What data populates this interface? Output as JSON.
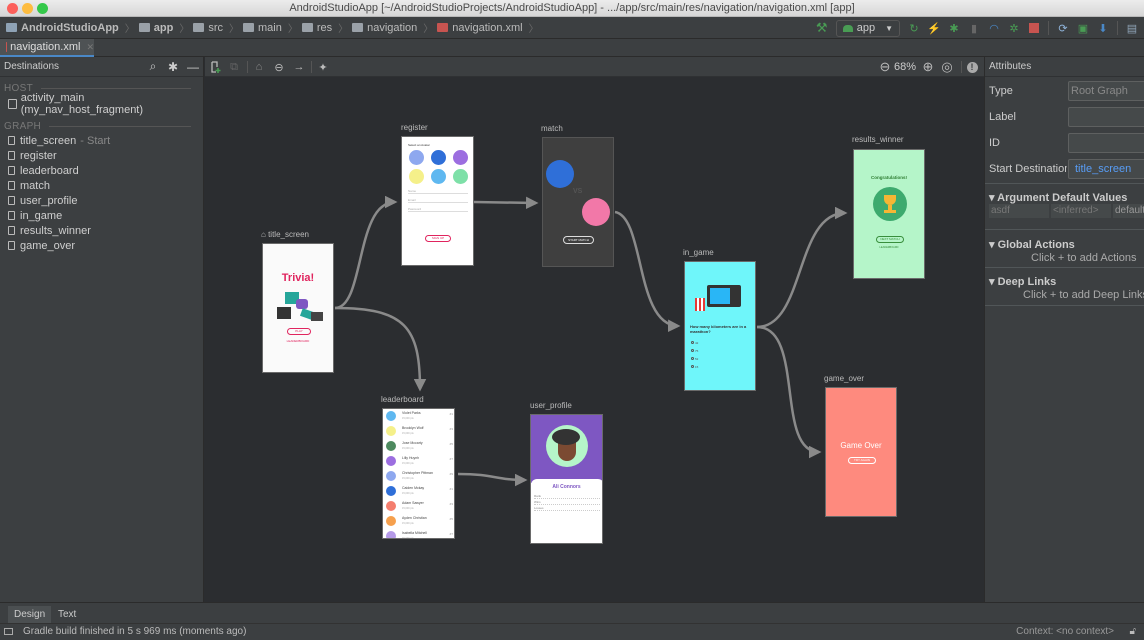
{
  "window": {
    "title": "AndroidStudioApp [~/AndroidStudioProjects/AndroidStudioApp] - .../app/src/main/res/navigation/navigation.xml [app]"
  },
  "breadcrumbs": [
    {
      "label": "AndroidStudioApp",
      "icon": "project-icon"
    },
    {
      "label": "app",
      "icon": "module-folder-icon"
    },
    {
      "label": "src",
      "icon": "folder-icon"
    },
    {
      "label": "main",
      "icon": "folder-icon"
    },
    {
      "label": "res",
      "icon": "res-folder-icon"
    },
    {
      "label": "navigation",
      "icon": "folder-icon"
    },
    {
      "label": "navigation.xml",
      "icon": "xml-file-icon"
    }
  ],
  "toolbar": {
    "run_config": "app",
    "icons": [
      "build-hammer-icon",
      "run-config-dropdown",
      "rerun-icon",
      "apply-changes-icon",
      "debug-icon",
      "attach-profiler-icon",
      "profile-icon",
      "attach-debugger-icon",
      "stop-icon",
      "sync-gradle-icon",
      "avd-manager-icon",
      "sdk-manager-icon",
      "project-structure-icon"
    ],
    "colors": {
      "green": "#499c54",
      "yellow": "#f0a732",
      "red": "#c75450",
      "blue": "#4a88c7"
    }
  },
  "editor_tab": {
    "label": "navigation.xml"
  },
  "destinations_panel": {
    "title": "Destinations",
    "host_label": "HOST",
    "host_item": "activity_main (my_nav_host_fragment)",
    "graph_label": "GRAPH",
    "start_suffix": "- Start",
    "items": [
      "title_screen",
      "register",
      "leaderboard",
      "match",
      "user_profile",
      "in_game",
      "results_winner",
      "game_over"
    ]
  },
  "editor_toolbar": {
    "zoom": "68%"
  },
  "graph": {
    "nodes": {
      "title_screen": {
        "label": "title_screen",
        "heading": "Trivia!",
        "button": "PLAY",
        "link": "LEADERBOARD"
      },
      "register": {
        "label": "register",
        "heading": "Select an Avatar",
        "fields": [
          "Name",
          "Email",
          "Password"
        ],
        "button": "SIGN UP"
      },
      "match": {
        "label": "match",
        "vs": "VS",
        "button": "START MATCH"
      },
      "leaderboard": {
        "label": "leaderboard",
        "rows": [
          {
            "name": "Violet Parks",
            "pts": "15,000 pts",
            "rank": "#1"
          },
          {
            "name": "Brooklyn Wolf",
            "pts": "15,000 pts",
            "rank": "#3"
          },
          {
            "name": "Jose Mccarty",
            "pts": "15,000 pts",
            "rank": "#5"
          },
          {
            "name": "Lilly Huynh",
            "pts": "15,000 pts",
            "rank": "#7"
          },
          {
            "name": "Christopher Pittman",
            "pts": "15,000 pts",
            "rank": "#9"
          },
          {
            "name": "Caiden Mckay",
            "pts": "15,000 pts",
            "rank": "#1"
          },
          {
            "name": "Adam Sawyer",
            "pts": "15,000 pts",
            "rank": "#3"
          },
          {
            "name": "Ayden Christian",
            "pts": "15,000 pts",
            "rank": "#5"
          },
          {
            "name": "Isabella Mitchell",
            "pts": "15,000 pts",
            "rank": "#7"
          }
        ]
      },
      "user_profile": {
        "label": "user_profile",
        "name": "Ali Connors",
        "stats": [
          "Rank",
          "Wins",
          "Losses"
        ]
      },
      "in_game": {
        "label": "in_game",
        "question": "How many kilometers are in a marathon?",
        "options": [
          "42",
          "75",
          "52",
          "15"
        ]
      },
      "results_winner": {
        "label": "results_winner",
        "heading": "Congratulations!",
        "button": "NEXT MATCH",
        "link": "LEADERBOARD"
      },
      "game_over": {
        "label": "game_over",
        "heading": "Game Over",
        "button": "TRY AGAIN"
      }
    },
    "colors": {
      "canvas": "#2b2d30",
      "edge": "#8a8a8a",
      "match_bg": "#3f3f3f",
      "in_game_bg": "#6ff6fa",
      "results_bg": "#b5f5c9",
      "game_over_bg": "#fe8a7e",
      "user_profile_header": "#7e57c2",
      "title_accent": "#e0245e"
    }
  },
  "attributes_panel": {
    "title": "Attributes",
    "rows": [
      {
        "label": "Type",
        "value": "Root Graph"
      },
      {
        "label": "Label",
        "value": ""
      },
      {
        "label": "ID",
        "value": ""
      },
      {
        "label": "Start Destination",
        "value": "title_screen"
      }
    ],
    "argument_section": "Argument Default Values",
    "argument_row": [
      "asdf",
      "<inferred>",
      "default"
    ],
    "global_actions": "Global Actions",
    "global_actions_hint": "Click + to add Actions",
    "deep_links": "Deep Links",
    "deep_links_hint": "Click + to add Deep Links"
  },
  "bottom_tabs": [
    "Design",
    "Text"
  ],
  "status": {
    "message": "Gradle build finished in 5 s 969 ms (moments ago)",
    "context": "Context: <no context>"
  }
}
